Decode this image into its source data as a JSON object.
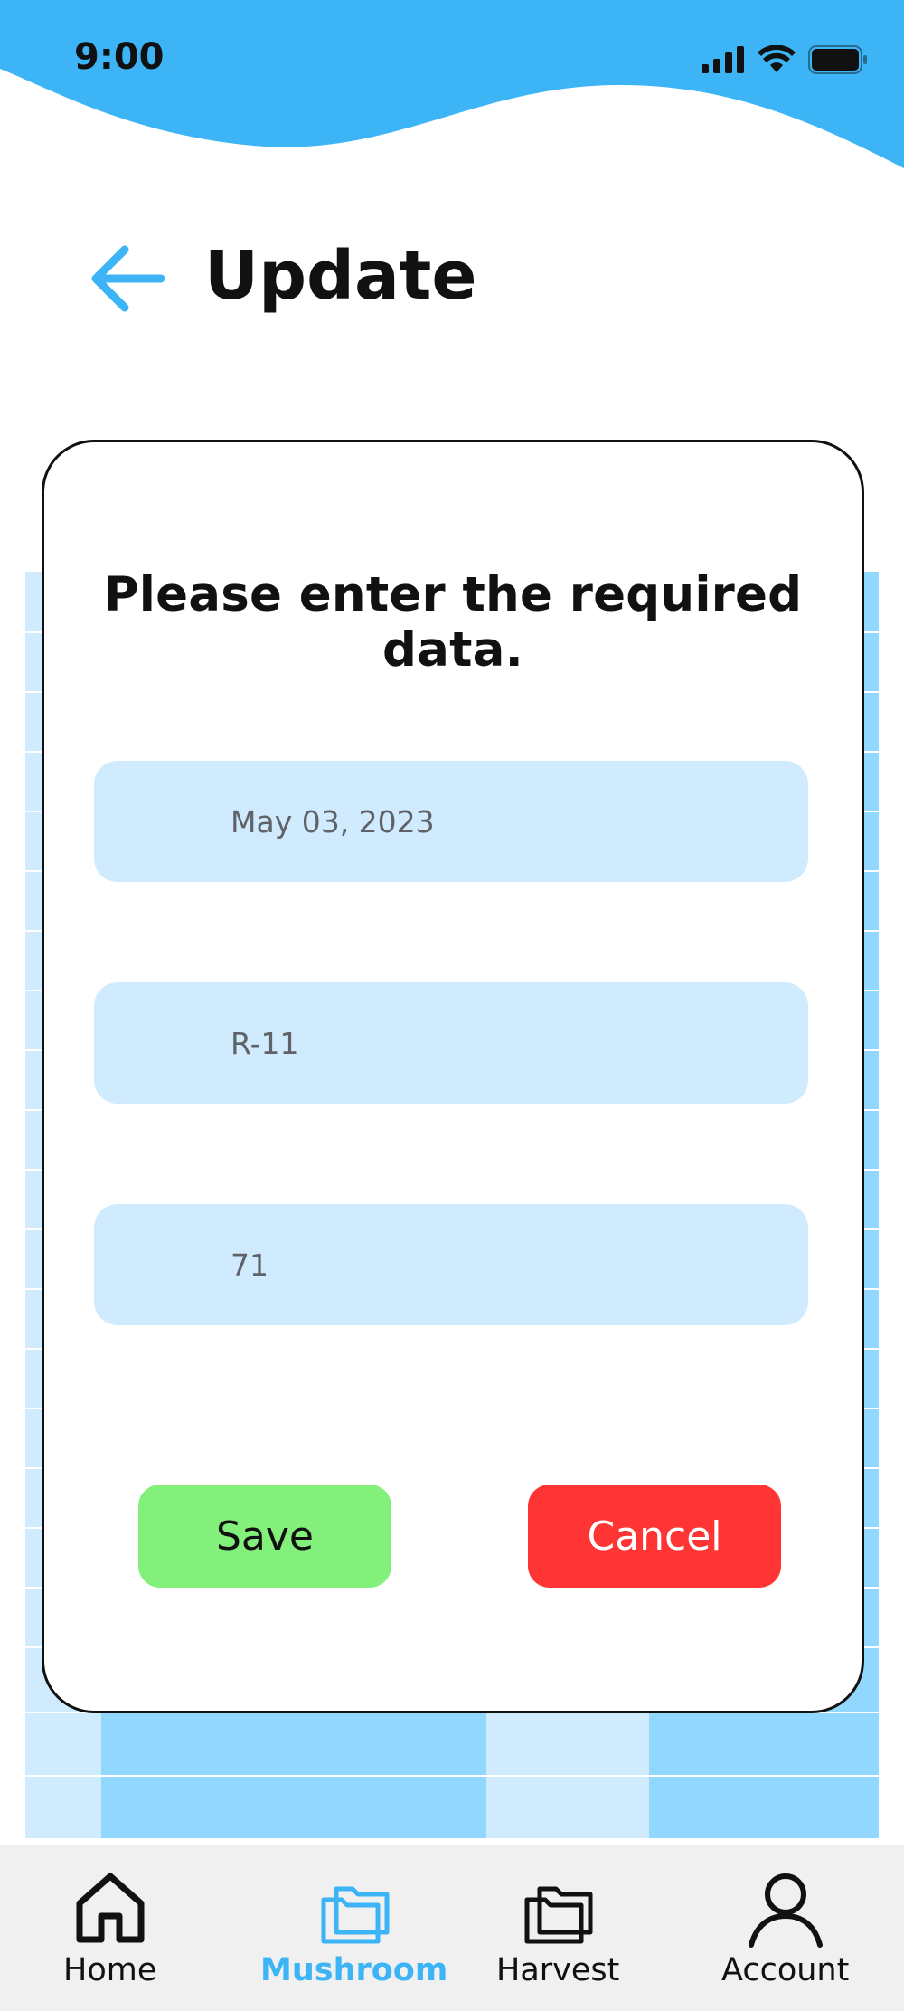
{
  "status_bar": {
    "time": "9:00"
  },
  "header": {
    "title": "Update"
  },
  "dialog": {
    "title": "Please enter the required data.",
    "fields": [
      {
        "value": "May 03, 2023"
      },
      {
        "value": "R-11"
      },
      {
        "value": "71"
      }
    ],
    "save_label": "Save",
    "cancel_label": "Cancel"
  },
  "tabbar": {
    "items": [
      {
        "label": "Home",
        "icon": "home-icon",
        "active": false
      },
      {
        "label": "Mushroom",
        "icon": "folder-icon",
        "active": true
      },
      {
        "label": "Harvest",
        "icon": "folder-icon",
        "active": false
      },
      {
        "label": "Account",
        "icon": "user-icon",
        "active": false
      }
    ]
  },
  "colors": {
    "accent": "#3cb4f5",
    "field_bg": "#d0ebfd",
    "save": "#82f07a",
    "cancel": "#ff3535"
  }
}
